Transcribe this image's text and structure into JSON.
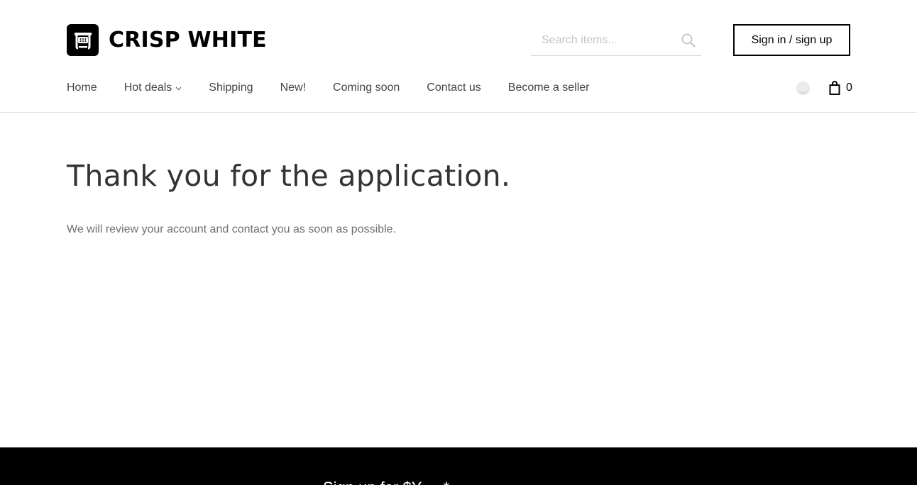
{
  "header": {
    "logo_text": "CRISP WHITE",
    "search": {
      "placeholder": "Search items..."
    },
    "signin_label": "Sign in / sign up",
    "cart_count": "0"
  },
  "nav": {
    "items": [
      {
        "label": "Home"
      },
      {
        "label": "Hot deals",
        "has_dropdown": true
      },
      {
        "label": "Shipping"
      },
      {
        "label": "New!"
      },
      {
        "label": "Coming soon"
      },
      {
        "label": "Contact us"
      },
      {
        "label": "Become a seller"
      }
    ]
  },
  "main": {
    "title": "Thank you for the application.",
    "message": "We will review your account and contact you as soon as possible."
  },
  "footer": {
    "partial_text": "Sign up for $Y ... *"
  },
  "icons": {
    "logo": "shop-logo-icon",
    "search": "search-icon",
    "chevron": "chevron-down-icon",
    "mode": "theme-toggle-icon",
    "cart": "shopping-bag-icon"
  },
  "colors": {
    "brand": "#000000",
    "text": "#333333",
    "muted": "#707070",
    "footer_bg": "#000000"
  }
}
